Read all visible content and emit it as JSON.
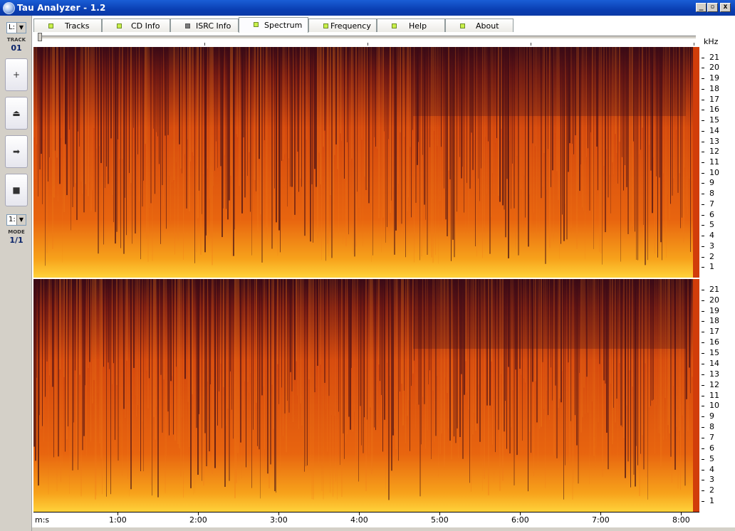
{
  "window": {
    "title": "Tau Analyzer - 1.2"
  },
  "winbuttons": {
    "minimize": "_",
    "maximize": "▫",
    "close": "x"
  },
  "sidebar": {
    "track_select": "L:",
    "track_label": "TRACK",
    "track_value": "01",
    "buttons": [
      "+",
      "⏏",
      "➡",
      "■"
    ],
    "mode_select": "1:",
    "mode_label": "MODE",
    "mode_value": "1/1"
  },
  "tabs": [
    {
      "label": "Tracks"
    },
    {
      "label": "CD Info"
    },
    {
      "label": "ISRC Info"
    },
    {
      "label": "Spectrum",
      "active": true
    },
    {
      "label": "Frequency"
    },
    {
      "label": "Help"
    },
    {
      "label": "About"
    }
  ],
  "axis": {
    "unit": "kHz",
    "khz_ticks": [
      "21",
      "20",
      "19",
      "18",
      "17",
      "16",
      "15",
      "14",
      "13",
      "12",
      "11",
      "10",
      "9",
      "8",
      "7",
      "6",
      "5",
      "4",
      "3",
      "2",
      "1"
    ],
    "time_origin": "m:s",
    "time_ticks": [
      "1:00",
      "2:00",
      "3:00",
      "4:00",
      "5:00",
      "6:00",
      "7:00",
      "8:00"
    ]
  },
  "colors": {
    "spectrum_dark": "#3a0a16",
    "spectrum_mid": "#d4470e",
    "spectrum_bright": "#f7a21b",
    "edge": "#d13d0a"
  }
}
